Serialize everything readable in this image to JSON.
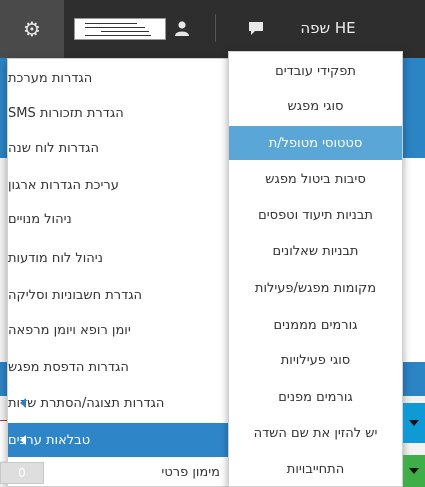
{
  "topbar": {
    "lang_label": "HE שפה",
    "icons": {
      "settings": "gear-icon",
      "user": "user-icon",
      "chat": "chat-icon"
    }
  },
  "menu_left": {
    "items": [
      "הגדרות מערכת",
      "הגדרת תזכורות SMS",
      "הגדרות לוח שנה",
      "עריכת הגדרות ארגון",
      "ניהול מנויים",
      "ניהול לוח מודעות",
      "הגדרת חשבוניות וסליקה",
      "יומן רופא ויומן מרפאה",
      "הגדרות הדפסת מפגש",
      "הגדרות תצוגה/הסתרת שדות",
      "טבלאות ערכים"
    ]
  },
  "menu_right": {
    "items": [
      "תפקידי עובדים",
      "סוגי מפגש",
      "סטטוסי מטופל/ת",
      "סיבות ביטול מפגש",
      "תבניות תיעוד וטפסים",
      "תבניות שאלונים",
      "מקומות מפגש/פעילות",
      "גורמים מממנים",
      "סוגי פעילויות",
      "גורמים מפנים",
      "יש להזין את שם השדה",
      "התחייבויות"
    ]
  },
  "background": {
    "row_label": "מימון פרטי",
    "badge_value": "0"
  },
  "colors": {
    "topbar": "#2e2e2e",
    "active_item": "#2e86c8",
    "highlight_item": "#5aa6d7",
    "accent_blue": "#2b84c4",
    "cyan_button": "#0f9ad6",
    "green_button": "#3fae49"
  }
}
